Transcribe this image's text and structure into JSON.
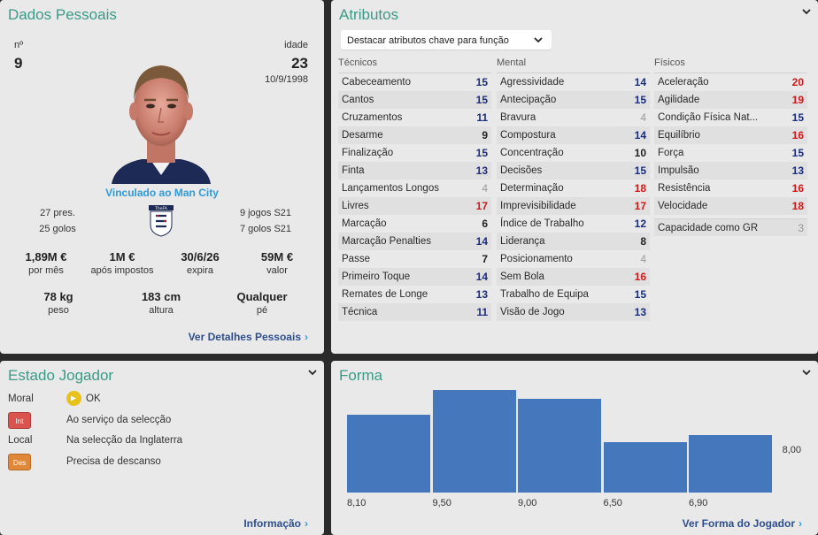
{
  "personal": {
    "title": "Dados Pessoais",
    "number_label": "nº",
    "number": "9",
    "age_label": "idade",
    "age": "23",
    "dob": "10/9/1998",
    "club_link": "Vinculado ao Man City",
    "club_apps": "27 pres.",
    "club_goals": "25 golos",
    "intl_apps": "9 jogos S21",
    "intl_goals": "7 golos S21",
    "wage": "1,89M €",
    "wage_label": "por mês",
    "after_tax": "1M €",
    "after_tax_label": "após impostos",
    "expires": "30/6/26",
    "expires_label": "expira",
    "value": "59M €",
    "value_label": "valor",
    "weight": "78 kg",
    "weight_label": "peso",
    "height": "183 cm",
    "height_label": "altura",
    "foot": "Qualquer",
    "foot_label": "pé",
    "crest_text": "TheFA",
    "details_link": "Ver Detalhes Pessoais"
  },
  "attributes": {
    "title": "Atributos",
    "highlight_dropdown": "Destacar atributos chave para função",
    "technical": {
      "header": "Técnicos",
      "items": [
        {
          "name": "Cabeceamento",
          "value": "15",
          "color": "blue"
        },
        {
          "name": "Cantos",
          "value": "15",
          "color": "blue"
        },
        {
          "name": "Cruzamentos",
          "value": "11",
          "color": "blue"
        },
        {
          "name": "Desarme",
          "value": "9",
          "color": "dark"
        },
        {
          "name": "Finalização",
          "value": "15",
          "color": "blue"
        },
        {
          "name": "Finta",
          "value": "13",
          "color": "blue"
        },
        {
          "name": "Lançamentos Longos",
          "value": "4",
          "color": "grey"
        },
        {
          "name": "Livres",
          "value": "17",
          "color": "red"
        },
        {
          "name": "Marcação",
          "value": "6",
          "color": "dark"
        },
        {
          "name": "Marcação Penalties",
          "value": "14",
          "color": "blue"
        },
        {
          "name": "Passe",
          "value": "7",
          "color": "dark"
        },
        {
          "name": "Primeiro Toque",
          "value": "14",
          "color": "blue"
        },
        {
          "name": "Remates de Longe",
          "value": "13",
          "color": "blue"
        },
        {
          "name": "Técnica",
          "value": "11",
          "color": "blue"
        }
      ]
    },
    "mental": {
      "header": "Mental",
      "items": [
        {
          "name": "Agressividade",
          "value": "14",
          "color": "blue"
        },
        {
          "name": "Antecipação",
          "value": "15",
          "color": "blue"
        },
        {
          "name": "Bravura",
          "value": "4",
          "color": "grey"
        },
        {
          "name": "Compostura",
          "value": "14",
          "color": "blue"
        },
        {
          "name": "Concentração",
          "value": "10",
          "color": "dark"
        },
        {
          "name": "Decisões",
          "value": "15",
          "color": "blue"
        },
        {
          "name": "Determinação",
          "value": "18",
          "color": "red"
        },
        {
          "name": "Imprevisibilidade",
          "value": "17",
          "color": "red"
        },
        {
          "name": "Índice de Trabalho",
          "value": "12",
          "color": "blue"
        },
        {
          "name": "Liderança",
          "value": "8",
          "color": "dark"
        },
        {
          "name": "Posicionamento",
          "value": "4",
          "color": "grey"
        },
        {
          "name": "Sem Bola",
          "value": "16",
          "color": "red"
        },
        {
          "name": "Trabalho de Equipa",
          "value": "15",
          "color": "blue"
        },
        {
          "name": "Visão de Jogo",
          "value": "13",
          "color": "blue"
        }
      ]
    },
    "physical": {
      "header": "Físicos",
      "items": [
        {
          "name": "Aceleração",
          "value": "20",
          "color": "red"
        },
        {
          "name": "Agilidade",
          "value": "19",
          "color": "red"
        },
        {
          "name": "Condição Física Nat...",
          "value": "15",
          "color": "blue"
        },
        {
          "name": "Equilíbrio",
          "value": "16",
          "color": "red"
        },
        {
          "name": "Força",
          "value": "15",
          "color": "blue"
        },
        {
          "name": "Impulsão",
          "value": "13",
          "color": "blue"
        },
        {
          "name": "Resistência",
          "value": "16",
          "color": "red"
        },
        {
          "name": "Velocidade",
          "value": "18",
          "color": "red"
        }
      ],
      "gk_label": "Capacidade como GR",
      "gk_value": "3"
    },
    "colors": {
      "blue": "#1a2d7a",
      "dark": "#222222",
      "grey": "#999999",
      "red": "#cc1a1a"
    }
  },
  "status": {
    "title": "Estado Jogador",
    "morale_label": "Moral",
    "morale_value": "OK",
    "int_badge": "Int",
    "int_text": "Ao serviço da selecção",
    "local_label": "Local",
    "local_value": "Na selecção da Inglaterra",
    "rest_badge": "Des",
    "rest_text": "Precisa de descanso",
    "info_link": "Informação"
  },
  "form": {
    "title": "Forma",
    "average_label": "8,00",
    "link": "Ver Forma do Jogador"
  },
  "chart_data": {
    "type": "bar",
    "categories": [
      "8,10",
      "9,50",
      "9,00",
      "6,50",
      "6,90"
    ],
    "values": [
      8.1,
      9.5,
      9.0,
      6.5,
      6.9
    ],
    "title": "",
    "xlabel": "",
    "ylabel": "",
    "ylim": [
      3.6,
      9.6
    ],
    "bar_color": "#4577bd",
    "grid": false,
    "average_line": "8,00"
  }
}
